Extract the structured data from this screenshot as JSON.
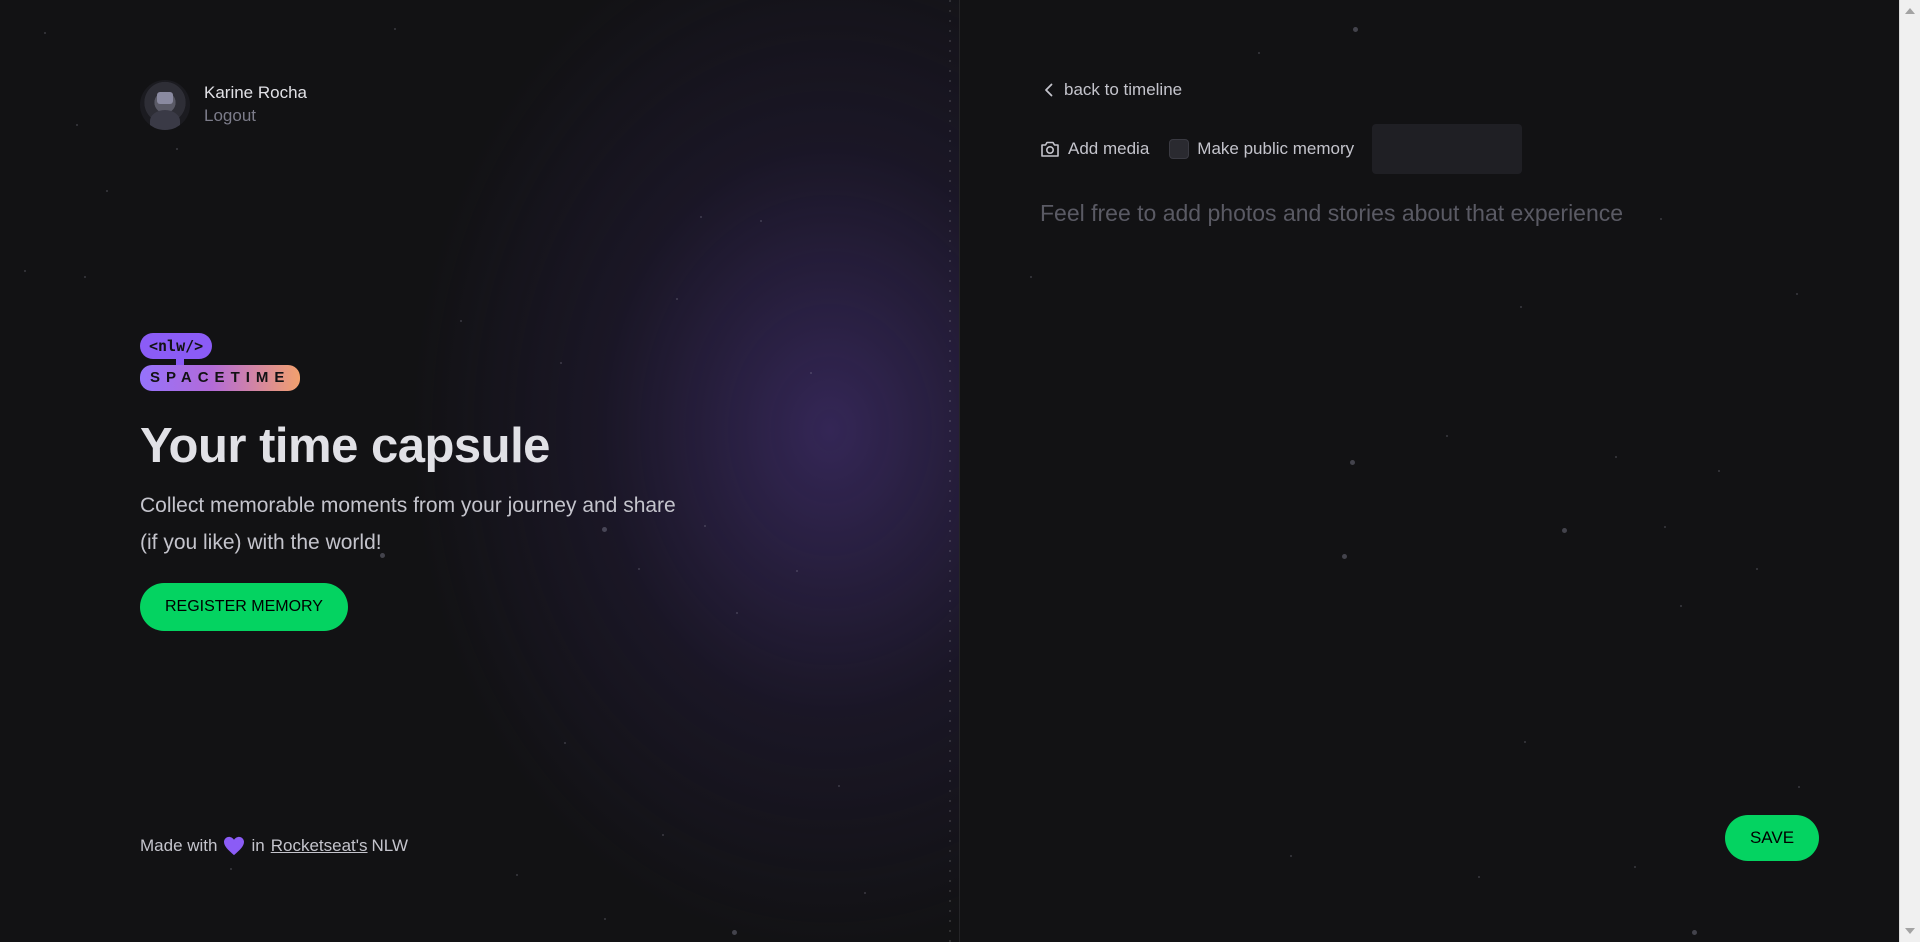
{
  "profile": {
    "name": "Karine Rocha",
    "logout_label": "Logout"
  },
  "logo": {
    "top": "<nlw/>",
    "bottom": "SPACETIME"
  },
  "hero": {
    "headline": "Your time capsule",
    "subtitle": "Collect memorable moments from your journey and share (if you like) with the world!",
    "register_label": "REGISTER MEMORY"
  },
  "footer": {
    "prefix": "Made with",
    "in": "in",
    "link_label": "Rocketseat's",
    "suffix": "NLW"
  },
  "editor": {
    "back_label": "back to timeline",
    "add_media_label": "Add media",
    "public_label": "Make public memory",
    "public_checked": false,
    "content_value": "",
    "content_placeholder": "Feel free to add photos and stories about that experience",
    "save_label": "SAVE"
  },
  "colors": {
    "background": "#121214",
    "accent_green": "#04d361",
    "accent_purple": "#8b5cf6",
    "text_primary": "#e1e1e6",
    "text_muted": "#7c7c8a"
  },
  "icons": [
    "chevron-left-icon",
    "camera-icon",
    "heart-icon"
  ]
}
